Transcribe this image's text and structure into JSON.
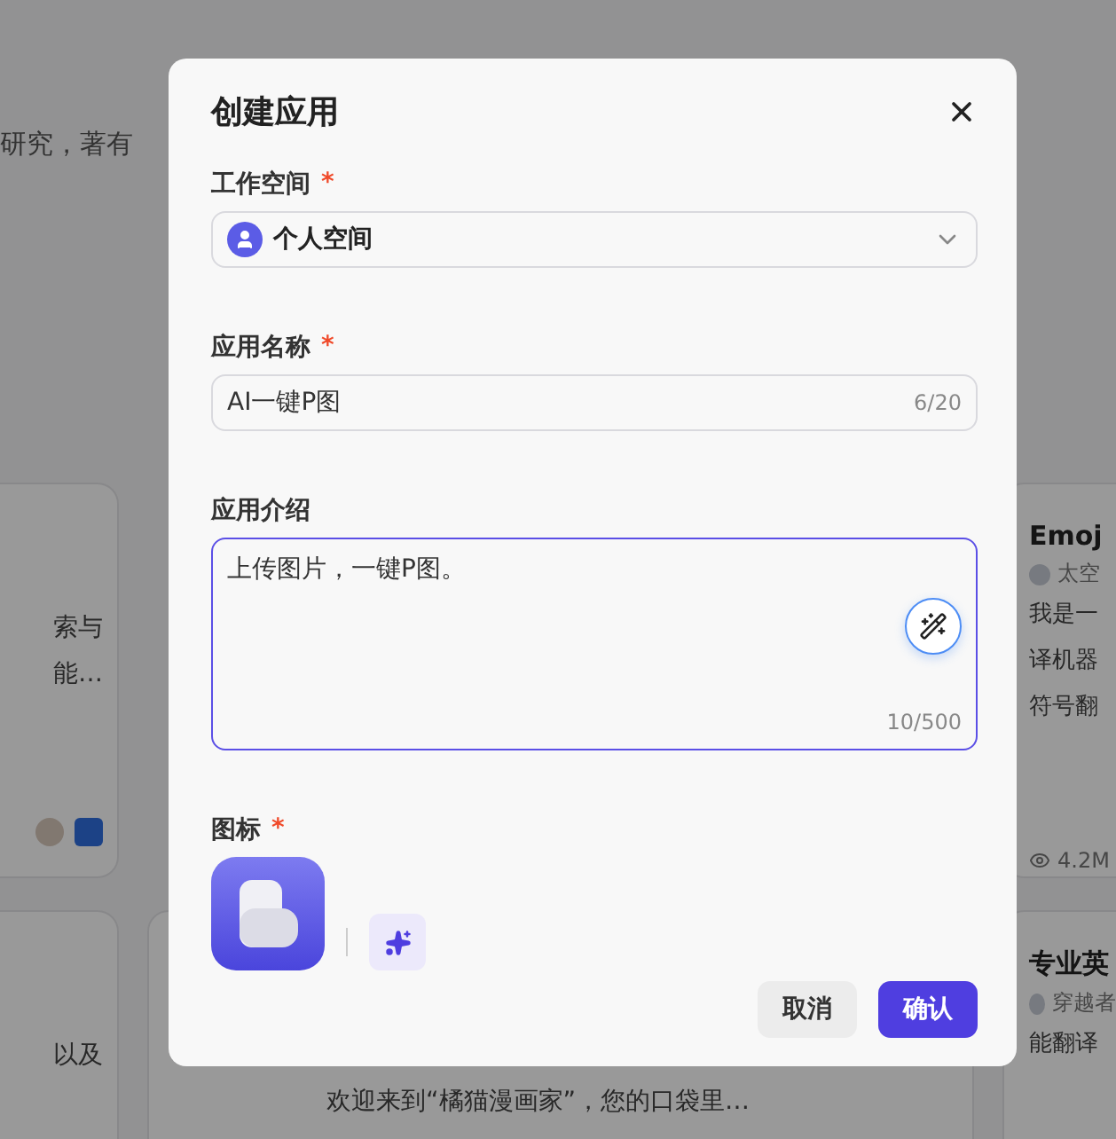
{
  "background": {
    "intro_fragment": "研究，著有",
    "cards": [
      {
        "kind": "left",
        "lines": [
          "索与",
          "能…"
        ],
        "icons": [
          {
            "kind": "avatar"
          },
          {
            "kind": "app"
          }
        ]
      },
      {
        "kind": "right",
        "title": "Emoj",
        "author": "太空",
        "lines": [
          "我是一",
          "译机器",
          "符号翻"
        ],
        "stat": "4.2M"
      },
      {
        "kind": "left",
        "lines": [
          "以及"
        ]
      },
      {
        "kind": "middle",
        "lines": [
          "欢迎来到“橘猫漫画家”，您的口袋里…"
        ]
      },
      {
        "kind": "right",
        "title": "专业英",
        "author": "穿越者",
        "lines": [
          "能翻译"
        ]
      }
    ]
  },
  "dialog": {
    "title": "创建应用",
    "fields": [
      {
        "kind": "select",
        "label": "工作空间",
        "required_mark": "*",
        "value": "个人空间"
      },
      {
        "kind": "input",
        "label": "应用名称",
        "required_mark": "*",
        "value": "AI一键P图",
        "counter": "6/20",
        "focused": false
      },
      {
        "kind": "textarea",
        "label": "应用介绍",
        "value": "上传图片，一键P图。",
        "counter": "10/500",
        "focused": true
      },
      {
        "kind": "icon",
        "label": "图标",
        "required_mark": "*"
      }
    ],
    "buttons": [
      {
        "kind": "secondary",
        "label": "取消"
      },
      {
        "kind": "primary",
        "label": "确认"
      }
    ]
  }
}
